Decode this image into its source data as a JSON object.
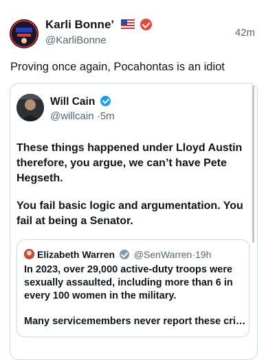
{
  "post": {
    "author_name": "Karli Bonne’",
    "author_handle": "@KarliBonne",
    "time": "42m",
    "text": "Proving once again, Pocahontas is an idiot"
  },
  "quoted": {
    "author_name": "Will Cain",
    "author_handle": "@willcain",
    "dot": "·",
    "time": "5m",
    "paragraph1": "These things happened under Lloyd Austin therefore, you argue, we can’t have Pete Hegseth.",
    "paragraph2": "You fail basic logic and argumentation. You fail at being a Senator."
  },
  "nested": {
    "author_name": "Elizabeth Warren",
    "author_handle": "@SenWarren",
    "dot": "·",
    "time": "19h",
    "paragraph1": "In 2023, over 29,000 active-duty troops were sexually assaulted, including more than 6 in every 100 women in the military.",
    "paragraph2": "Many servicemembers never report these cri…"
  },
  "icons": {
    "verified_badge": "verified-badge-icon",
    "flag": "us-flag-icon"
  },
  "colors": {
    "text": "#0f1419",
    "secondary": "#536471",
    "border": "#cfd9de",
    "verified_blue": "#1d9bf0",
    "verified_red": "#e24b3b",
    "verified_gray": "#829aab"
  }
}
